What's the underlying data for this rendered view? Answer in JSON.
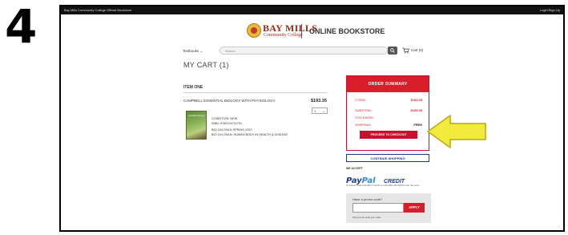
{
  "step_number": "4",
  "topbar": {
    "title": "Bay Mills Community College Official Bookstore",
    "login": "Login/Sign Up"
  },
  "header": {
    "logo_line1": "BAY MILLS",
    "logo_line2": "Community College",
    "store_title": "ONLINE BOOKSTORE"
  },
  "nav": {
    "textbooks_label": "Textbooks ⌄",
    "search_placeholder": "Search",
    "cart_label": "Cart (0)"
  },
  "cart": {
    "title": "MY CART (1)",
    "section_label": "ITEM ONE",
    "item": {
      "title": "CAMPBELL ESSENTIAL BIOLOGY WITH PHYSIOLOGY",
      "price": "$193.35",
      "quantity": "1",
      "book_cover_text": "essential biology",
      "condition": "CONDITION: NEW",
      "isbn": "ISBN: 9780134711751",
      "course": "BIO 104 ONLN  SPRING 2022",
      "course_desc": "BIO 104 ONLN: HUMAN BODY IN HEALTH & DISEASE"
    }
  },
  "summary": {
    "header": "ORDER SUMMARY",
    "rows": [
      {
        "label": "1 ITEM",
        "value": "$193.35"
      },
      {
        "label": "SUBTOTAL:",
        "value": "$193.35"
      },
      {
        "label": "YOU SAVED:",
        "value": ""
      },
      {
        "label": "SHIPPING:",
        "value": "FREE"
      }
    ],
    "checkout_label": "PROCEED TO CHECKOUT"
  },
  "continue_label": "CONTINUE SHOPPING",
  "payment": {
    "we_accept": "WE ACCEPT",
    "paypal_text1": "Pay",
    "paypal_text2": "Pal",
    "credit_text": "CREDIT",
    "fine_print": "No Interest if paid in full within 6 months on online $99+ with PayPal Credit. See terms."
  },
  "promo": {
    "label": "Have a promo code?",
    "input_value": "",
    "apply_label": "APPLY",
    "note": "One promo code per order."
  },
  "colors": {
    "accent_red": "#d81e2a",
    "arrow_yellow": "#f2ea3c",
    "link_blue": "#1f3a8a"
  }
}
